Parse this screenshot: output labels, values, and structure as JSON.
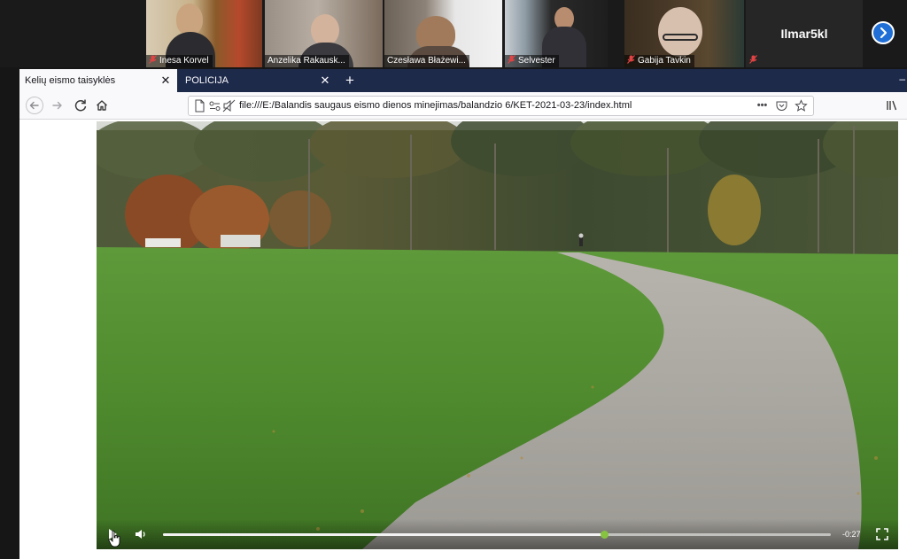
{
  "call": {
    "participants": [
      {
        "name": "Inesa Korvel",
        "muted": true
      },
      {
        "name": "Anzelika Rakausk...",
        "muted": false
      },
      {
        "name": "Czesława Błażewi...",
        "muted": false
      },
      {
        "name": "Selvester",
        "muted": true
      },
      {
        "name": "Gabija Tavkin",
        "muted": true
      }
    ],
    "name_only_tile": {
      "name": "Ilmar5kl",
      "muted": true
    },
    "next_icon": "chevron-right-icon"
  },
  "browser": {
    "tabs": [
      {
        "title": "Kelių eismo taisyklės",
        "active": true
      },
      {
        "title": "POLICIJA",
        "active": false
      }
    ],
    "url": "file:///E:/Balandis saugaus eismo dienos minejimas/balandzio 6/KET-2021-03-23/index.html"
  },
  "video": {
    "time_remaining": "-0:27",
    "progress": 0.66,
    "state": "paused"
  },
  "colors": {
    "tabbar": "#1e2a4a",
    "accent_progress": "#86c440",
    "call_next_button": "#1f6fd6"
  }
}
